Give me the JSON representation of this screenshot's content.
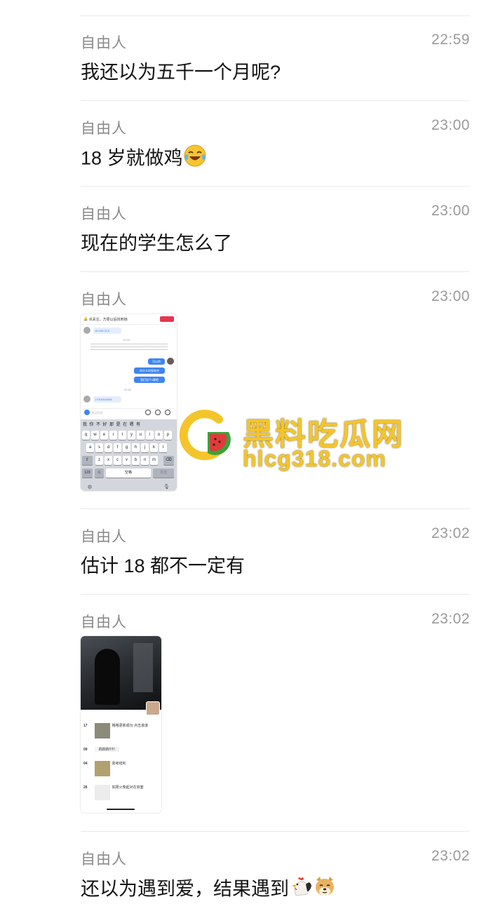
{
  "messages": [
    {
      "name": "自由人",
      "time": "22:59",
      "text": "我还以为五千一个月呢?"
    },
    {
      "name": "自由人",
      "time": "23:00",
      "text": "18 岁就做鸡"
    },
    {
      "name": "自由人",
      "time": "23:00",
      "text": "现在的学生怎么了"
    },
    {
      "name": "自由人",
      "time": "23:00"
    },
    {
      "name": "自由人",
      "time": "23:02",
      "text": "估计 18 都不一定有"
    },
    {
      "name": "自由人",
      "time": "23:02"
    },
    {
      "name": "自由人",
      "time": "23:02",
      "text": "还以为遇到爱，结果遇到"
    }
  ],
  "screenshot1": {
    "top_bar": "点关注，方便以后找到她",
    "number1": "18.185.00.5",
    "time1": "10:15",
    "bubble_texts": [
      "可以的",
      "你什么时候有空",
      "我们加个v聊吧"
    ],
    "time2": "22:53",
    "number2": "17918345538",
    "input_placeholder": "发送消息",
    "candidates": [
      "我",
      "你",
      "不",
      "好",
      "那",
      "是",
      "在",
      "嗯",
      "有"
    ],
    "row1": [
      "q",
      "w",
      "e",
      "r",
      "t",
      "y",
      "u",
      "i",
      "o",
      "p"
    ],
    "row2": [
      "a",
      "s",
      "d",
      "f",
      "g",
      "h",
      "j",
      "k",
      "l"
    ],
    "row3": [
      "z",
      "x",
      "c",
      "v",
      "b",
      "n",
      "m"
    ],
    "num_key": "123",
    "space_key": "空格",
    "send_key": "发送"
  },
  "watermark": {
    "title": "黑料吃瓜网",
    "url": "hlcg318.com"
  },
  "screenshot2": {
    "entries": [
      {
        "day": "17",
        "text": "格格更新成功 点击滚滚"
      },
      {
        "day": "09",
        "text": "四四四!!!!!!"
      },
      {
        "day": "04",
        "text": "高考结利"
      },
      {
        "day": "26",
        "text": "如周火柴起对在双套"
      }
    ]
  },
  "emoji_names": [
    "crying-laughing-face-icon",
    "rooster-icon",
    "doge-icon"
  ],
  "colors": {
    "name": "#8a8a8a",
    "time": "#9a9a9a",
    "divider": "#e9e9e9",
    "watermark": "#f4c52a",
    "bubble_blue": "#3d85f2"
  }
}
